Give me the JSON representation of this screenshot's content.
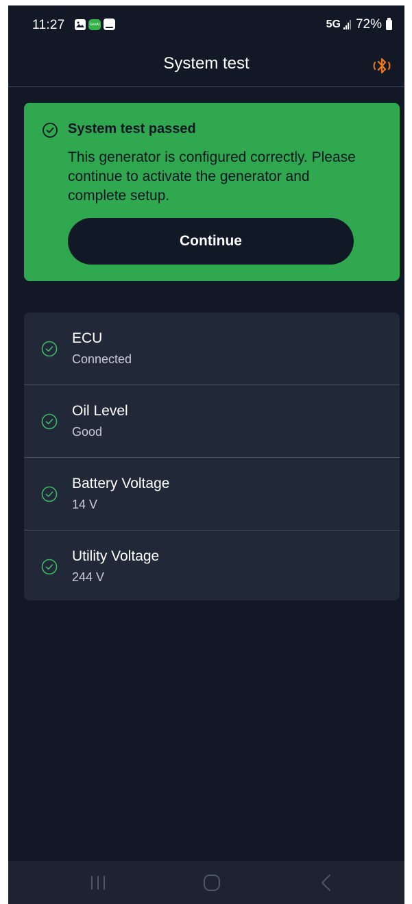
{
  "status_bar": {
    "time": "11:27",
    "network": "5G",
    "battery": "72%",
    "app_badge": "GenAI"
  },
  "header": {
    "title": "System test",
    "bluetooth_icon": "bluetooth-icon",
    "accent_color": "#f07a1a"
  },
  "success": {
    "icon": "check-circle-icon",
    "title": "System test passed",
    "message": "This generator is configured correctly. Please continue to activate the generator and complete setup.",
    "button_label": "Continue",
    "background_color": "#2fa84f"
  },
  "checks": [
    {
      "icon": "check-circle-icon",
      "label": "ECU",
      "value": "Connected"
    },
    {
      "icon": "check-circle-icon",
      "label": "Oil Level",
      "value": "Good"
    },
    {
      "icon": "check-circle-icon",
      "label": "Battery Voltage",
      "value": "14 V"
    },
    {
      "icon": "check-circle-icon",
      "label": "Utility Voltage",
      "value": "244 V"
    }
  ],
  "nav": {
    "recents_icon": "recent-apps-icon",
    "home_icon": "home-icon",
    "back_icon": "back-icon"
  },
  "colors": {
    "background": "#121826",
    "card": "#212938",
    "status_ok": "#3fb968"
  }
}
